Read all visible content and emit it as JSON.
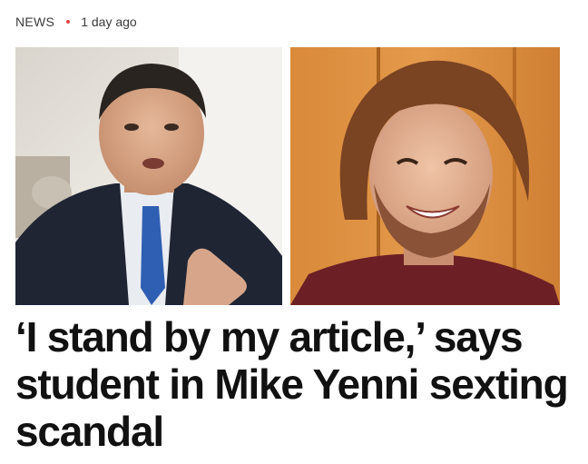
{
  "article": {
    "category": "NEWS",
    "time_ago": "1 day ago",
    "headline": "‘I stand by my article,’ says student in Mike Yenni sexting scandal",
    "images": [
      {
        "name": "politician-photo"
      },
      {
        "name": "student-photo"
      }
    ]
  },
  "colors": {
    "dot": "#e04545",
    "headline_text": "#111111",
    "meta_text": "#3b3b3b"
  }
}
